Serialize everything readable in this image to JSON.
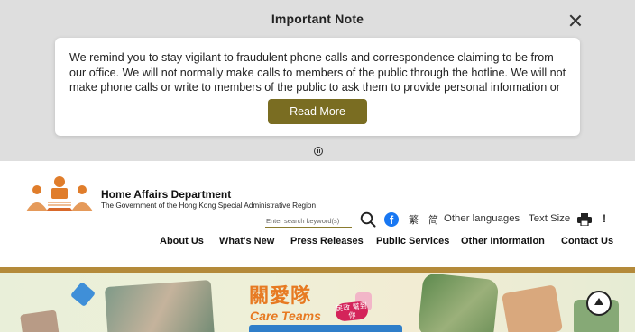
{
  "notice": {
    "title": "Important Note",
    "close_icon": "close-icon",
    "text": "We remind you to stay vigilant to fraudulent phone calls and correspondence claiming to be from our office. We will not normally make calls to members of the public through the hotline. We will not make phone calls or write to members of the public to ask them to provide personal information or make",
    "read_more_label": "Read More",
    "pause_icon": "pause-icon"
  },
  "header": {
    "dept_name": "Home Affairs Department",
    "dept_sub": "The Government of the Hong Kong Special Administrative Region",
    "search_placeholder": "Enter search keyword(s)",
    "lang_tc": "繁",
    "lang_sc": "简",
    "other_languages": "Other languages",
    "text_size": "Text Size",
    "alert_symbol": "!",
    "facebook_glyph": "f"
  },
  "nav": {
    "items": [
      {
        "label": "About Us"
      },
      {
        "label": "What's New"
      },
      {
        "label": "Press Releases"
      },
      {
        "label": "Public Services"
      },
      {
        "label": "Other Information"
      },
      {
        "label": "Contact Us"
      }
    ]
  },
  "banner": {
    "title_cn": "關愛隊",
    "title_en": "Care Teams",
    "badge_text": "民政 幫到你"
  },
  "colors": {
    "accent_button": "#7a6d22",
    "header_rule": "#b48a3a",
    "banner_orange": "#e77a22",
    "notice_bg": "#dedede"
  }
}
